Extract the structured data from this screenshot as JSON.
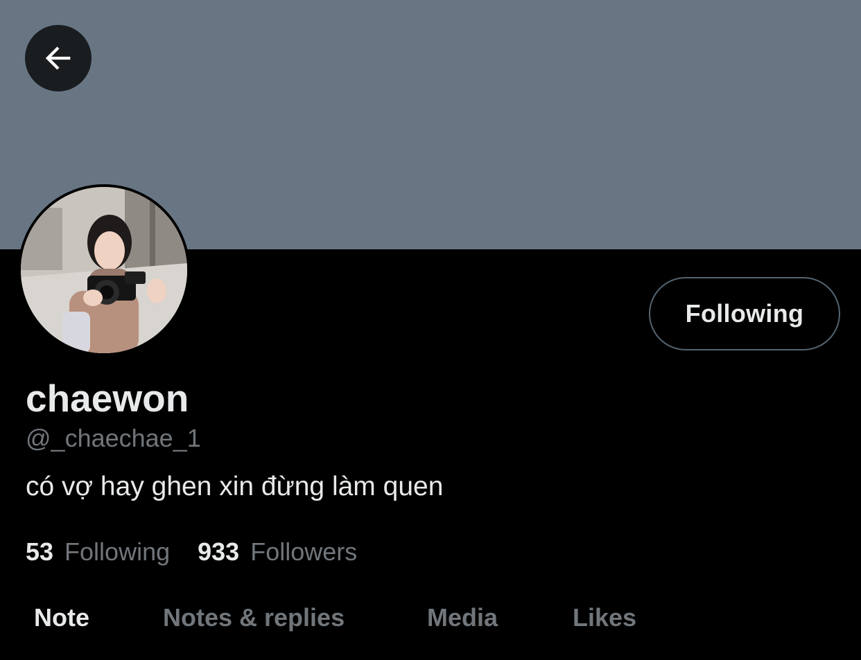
{
  "header": {
    "back_icon": "arrow-left-icon"
  },
  "profile": {
    "display_name": "chaewon",
    "handle": "@_chaechae_1",
    "bio": "có vợ hay ghen xin đừng làm quen",
    "follow_button_label": "Following",
    "following_count": "53",
    "following_label": "Following",
    "followers_count": "933",
    "followers_label": "Followers"
  },
  "tabs": [
    {
      "label": "Note",
      "active": true
    },
    {
      "label": "Notes & replies",
      "active": false
    },
    {
      "label": "Media",
      "active": false
    },
    {
      "label": "Likes",
      "active": false
    }
  ],
  "colors": {
    "banner": "#687684",
    "background": "#000000",
    "primary_text": "#e7e9ea",
    "secondary_text": "#71767b",
    "button_border": "#536471"
  }
}
